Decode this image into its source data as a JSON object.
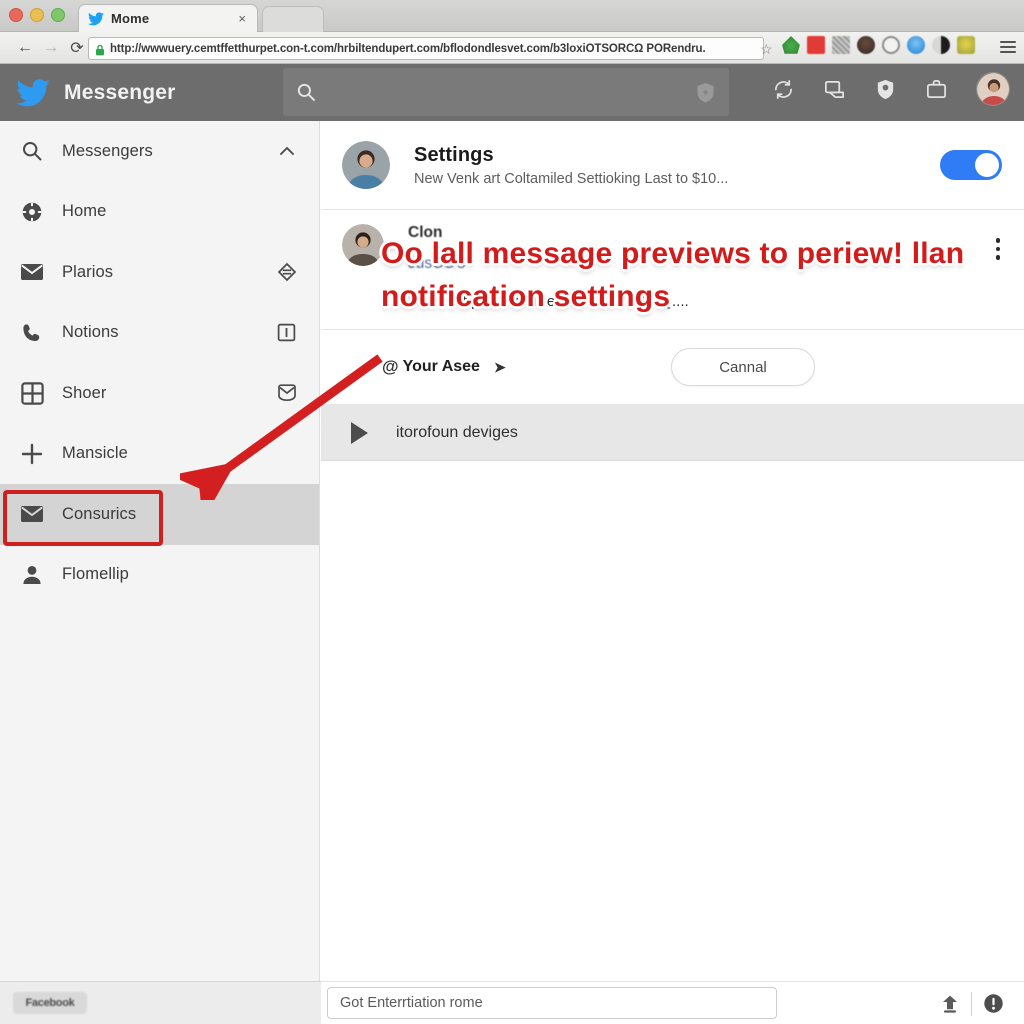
{
  "browser": {
    "tab": {
      "title": "Mome",
      "favicon": "twitter-bird-icon",
      "close_label": "×"
    },
    "nav": {
      "back": "←",
      "forward": "→",
      "reload": "⟳"
    },
    "omnibox": {
      "url": "http://wwwuery.cemtffetthurpet.con-t.com/hrbiltendupert.com/bflodondlesvet.com/b3loxiOTSORCΩ PORendru.",
      "lock_icon": "lock-icon",
      "bookmark_icon": "star-icon"
    },
    "extensions": [
      "ext-green-home",
      "ext-red",
      "ext-gray",
      "ext-avatar",
      "ext-clock",
      "ext-blue",
      "ext-dark",
      "ext-yellow"
    ],
    "menu_icon": "hamburger-icon"
  },
  "app": {
    "brand": "Messenger",
    "brand_logo": "twitter-bird-icon",
    "search": {
      "value": "",
      "placeholder": "",
      "icon": "search-icon",
      "trailing_icon": "shield-icon"
    },
    "header_icons": [
      "refresh-icon",
      "inbox-icon",
      "shield-icon",
      "briefcase-icon"
    ],
    "avatar": "user-avatar"
  },
  "sidebar": {
    "items": [
      {
        "label": "Messengers",
        "icon": "search-icon",
        "trailing": "chevron-up-icon",
        "selected": false
      },
      {
        "label": "Home",
        "icon": "compass-icon",
        "trailing": "",
        "selected": false
      },
      {
        "label": "Plarios",
        "icon": "mail-icon",
        "trailing": "diamond-icon",
        "selected": false
      },
      {
        "label": "Notions",
        "icon": "phone-icon",
        "trailing": "square-info-icon",
        "selected": false
      },
      {
        "label": "Shoer",
        "icon": "grid-icon",
        "trailing": "envelope-open-icon",
        "selected": false
      },
      {
        "label": "Mansicle",
        "icon": "plus-icon",
        "trailing": "",
        "selected": false
      },
      {
        "label": "Consurics",
        "icon": "mail-icon",
        "trailing": "",
        "selected": true
      },
      {
        "label": "Flomellip",
        "icon": "person-icon",
        "trailing": "",
        "selected": false
      }
    ]
  },
  "main": {
    "settings_row": {
      "title": "Settings",
      "subtitle": "New Venk art Coltamiled Settioking Last to $10...",
      "avatar": "contact-avatar",
      "toggle_on": true
    },
    "notification_row": {
      "line1": "Clon",
      "line2": "JusCC's",
      "line3": "Faker off previews mee by bec fol SSIQ....",
      "kebab": "more-options-icon"
    },
    "overlay_annotation": "Oo lall message previews to periew! llan notification settings",
    "action_row": {
      "at_label": "Your Asee",
      "at_symbol": "@",
      "chevron": "chevron-right-icon",
      "cancel_label": "Cannal"
    },
    "devices_row": {
      "label": "itorofoun deviges",
      "icon": "play-triangle-icon"
    }
  },
  "bottom": {
    "badge": "Facebook",
    "message_input": {
      "value": "Got Enterrtiation rome",
      "placeholder": "Got Enterrtiation rome"
    },
    "tools": [
      "upload-icon",
      "info-icon"
    ]
  },
  "colors": {
    "accent_blue": "#2f7cf6",
    "annotation_red": "#d41b1b",
    "header_gray": "#6d6d6d",
    "sidebar_bg": "#f4f4f4",
    "selected_row": "#d4d4d4"
  }
}
